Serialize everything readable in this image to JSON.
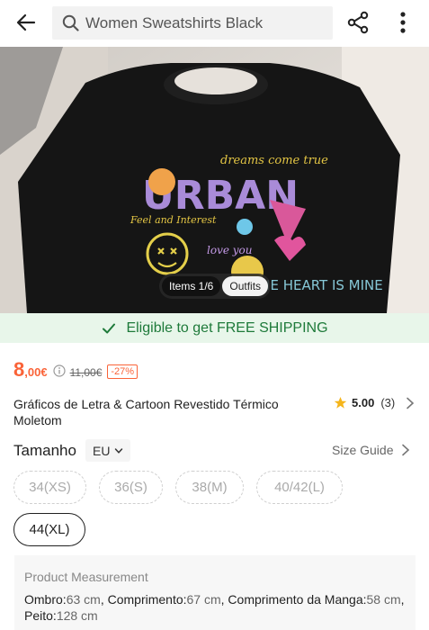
{
  "header": {
    "search_text": "Women Sweatshirts Black",
    "icons": [
      "back-arrow-icon",
      "search-icon",
      "share-icon",
      "more-vertical-icon"
    ]
  },
  "image": {
    "tabs": [
      "Items 1/6",
      "Outfits"
    ]
  },
  "shipping": {
    "text": "Eligible to get FREE SHIPPING",
    "color": "#1e7a3a"
  },
  "price": {
    "main": "8",
    "decimal": ",00€",
    "original": "11,00€",
    "discount": "-27%",
    "accent": "#fa6338"
  },
  "product": {
    "title": "Gráficos de Letra & Cartoon Revestido Térmico Moletom",
    "rating": "5.00",
    "review_count": "(3)"
  },
  "size": {
    "label": "Tamanho",
    "region": "EU",
    "guide_label": "Size Guide",
    "options": [
      "34(XS)",
      "36(S)",
      "38(M)",
      "40/42(L)",
      "44(XL)"
    ],
    "selected": "44(XL)"
  },
  "measurement": {
    "title": "Product Measurement",
    "items": [
      {
        "label": "Ombro:",
        "value": "63 cm",
        "sep": ", "
      },
      {
        "label": "Comprimento:",
        "value": "67 cm",
        "sep": ", "
      },
      {
        "label": "Comprimento da Manga:",
        "value": "58 cm",
        "sep": ", "
      },
      {
        "label": "Peito:",
        "value": "128 cm",
        "sep": ""
      }
    ]
  }
}
